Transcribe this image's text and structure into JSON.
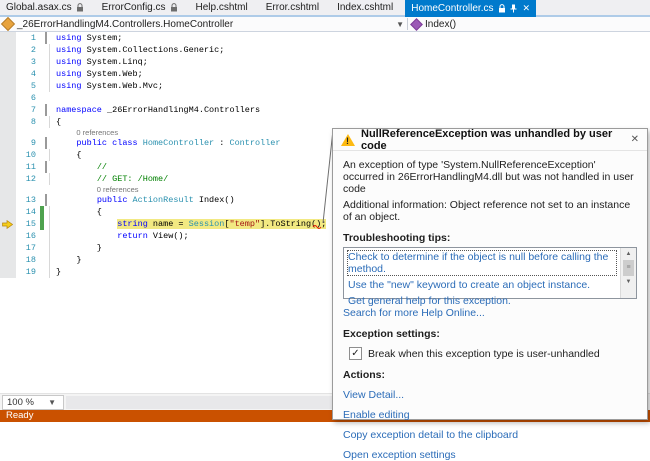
{
  "tabs": [
    {
      "label": "Global.asax.cs",
      "lock": true,
      "active": false
    },
    {
      "label": "ErrorConfig.cs",
      "lock": true,
      "active": false
    },
    {
      "label": "Help.cshtml",
      "lock": false,
      "active": false
    },
    {
      "label": "Error.cshtml",
      "lock": false,
      "active": false
    },
    {
      "label": "Index.cshtml",
      "lock": false,
      "active": false
    },
    {
      "label": "HomeController.cs",
      "lock": true,
      "active": true
    }
  ],
  "navbar": {
    "type_path": "_26ErrorHandlingM4.Controllers.HomeController",
    "member": "Index()"
  },
  "editor": {
    "codelens_label": "0 references",
    "lines": [
      {
        "n": 1,
        "box": true,
        "segs": [
          [
            "k",
            "using"
          ],
          [
            "p",
            " System;"
          ]
        ]
      },
      {
        "n": 2,
        "guide": true,
        "segs": [
          [
            "k",
            "using"
          ],
          [
            "p",
            " System.Collections.Generic;"
          ]
        ]
      },
      {
        "n": 3,
        "guide": true,
        "segs": [
          [
            "k",
            "using"
          ],
          [
            "p",
            " System.Linq;"
          ]
        ]
      },
      {
        "n": 4,
        "guide": true,
        "segs": [
          [
            "k",
            "using"
          ],
          [
            "p",
            " System.Web;"
          ]
        ]
      },
      {
        "n": 5,
        "guide": true,
        "segs": [
          [
            "k",
            "using"
          ],
          [
            "p",
            " System.Web.Mvc;"
          ]
        ]
      },
      {
        "n": 6,
        "segs": []
      },
      {
        "n": 7,
        "box": true,
        "segs": [
          [
            "k",
            "namespace"
          ],
          [
            "p",
            " _26ErrorHandlingM4.Controllers"
          ]
        ]
      },
      {
        "n": 8,
        "guide": true,
        "segs": [
          [
            "p",
            "{"
          ]
        ]
      },
      {
        "codelens": true,
        "indent": 4
      },
      {
        "n": 9,
        "box": true,
        "segs": [
          [
            "p",
            "    "
          ],
          [
            "k",
            "public"
          ],
          [
            "p",
            " "
          ],
          [
            "k",
            "class"
          ],
          [
            "p",
            " "
          ],
          [
            "t",
            "HomeController"
          ],
          [
            "p",
            " : "
          ],
          [
            "t",
            "Controller"
          ]
        ]
      },
      {
        "n": 10,
        "guide": true,
        "segs": [
          [
            "p",
            "    {"
          ]
        ]
      },
      {
        "n": 11,
        "box": true,
        "segs": [
          [
            "p",
            "        "
          ],
          [
            "c",
            "//"
          ]
        ]
      },
      {
        "n": 12,
        "guide": true,
        "segs": [
          [
            "p",
            "        "
          ],
          [
            "c",
            "// GET: /Home/"
          ]
        ]
      },
      {
        "codelens": true,
        "indent": 8
      },
      {
        "n": 13,
        "box": true,
        "segs": [
          [
            "p",
            "        "
          ],
          [
            "k",
            "public"
          ],
          [
            "p",
            " "
          ],
          [
            "t",
            "ActionResult"
          ],
          [
            "p",
            " Index()"
          ]
        ]
      },
      {
        "n": 14,
        "guide": true,
        "chg": true,
        "segs": [
          [
            "p",
            "        {"
          ]
        ]
      },
      {
        "n": 15,
        "guide": true,
        "chg": true,
        "cur": true,
        "hlFrom": 1,
        "segs": [
          [
            "p",
            "            "
          ],
          [
            "k",
            "string"
          ],
          [
            "p",
            " name = "
          ],
          [
            "t",
            "Session"
          ],
          [
            "p",
            "["
          ],
          [
            "s",
            "\"temp\""
          ],
          [
            "p",
            "].ToString()"
          ],
          [
            "e",
            ";"
          ]
        ]
      },
      {
        "n": 16,
        "guide": true,
        "segs": [
          [
            "p",
            "            "
          ],
          [
            "k",
            "return"
          ],
          [
            "p",
            " View();"
          ]
        ]
      },
      {
        "n": 17,
        "guide": true,
        "segs": [
          [
            "p",
            "        }"
          ]
        ]
      },
      {
        "n": 18,
        "guide": true,
        "segs": [
          [
            "p",
            "    }"
          ]
        ]
      },
      {
        "n": 19,
        "guide": true,
        "segs": [
          [
            "p",
            "}"
          ]
        ]
      }
    ]
  },
  "exception_popup": {
    "title": "NullReferenceException was unhandled by user code",
    "message": "An exception of type 'System.NullReferenceException' occurred in 26ErrorHandlingM4.dll but was not handled in user code",
    "additional": "Additional information: Object reference not set to an instance of an object.",
    "tips_label": "Troubleshooting tips:",
    "tips": [
      "Check to determine if the object is null before calling the method.",
      "Use the \"new\" keyword to create an object instance.",
      "Get general help for this exception."
    ],
    "search_link": "Search for more Help Online...",
    "settings_label": "Exception settings:",
    "break_checkbox_label": "Break when this exception type is user-unhandled",
    "break_checkbox_checked": true,
    "actions_label": "Actions:",
    "actions": [
      "View Detail...",
      "Enable editing",
      "Copy exception detail to the clipboard",
      "Open exception settings"
    ]
  },
  "zoom_control": {
    "value": "100 %"
  },
  "status_bar": {
    "text": "Ready"
  },
  "colors": {
    "accent_active_tab": "#007ACC",
    "status_bar_debug_orange": "#CA5100",
    "current_statement_highlight": "#F2E982",
    "keyword": "#0000FF",
    "type_name": "#2B91AF",
    "string_literal": "#A31515",
    "comment": "#008000",
    "link": "#2B6CB8",
    "change_bar_green": "#4EA24E",
    "error_red": "#E51400"
  }
}
